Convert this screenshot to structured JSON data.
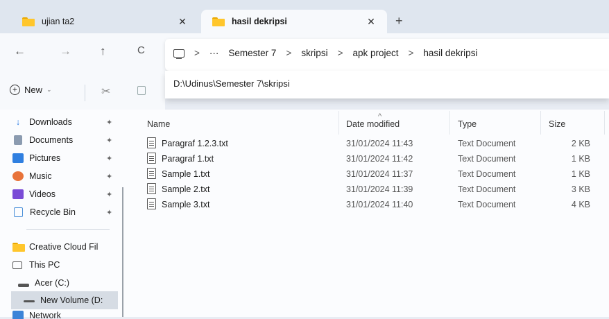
{
  "tabs": [
    {
      "title": "ujian ta2",
      "active": false
    },
    {
      "title": "hasil dekripsi",
      "active": true
    }
  ],
  "tab_close_glyph": "✕",
  "new_tab_glyph": "+",
  "nav": {
    "back": "←",
    "forward": "→",
    "up": "↑",
    "refresh": "C"
  },
  "breadcrumb": {
    "overflow": "···",
    "separator": ">",
    "items": [
      "Semester 7",
      "skripsi",
      "apk project",
      "hasil dekripsi"
    ]
  },
  "address_suggestion": "D:\\Udinus\\Semester 7\\skripsi",
  "toolbar": {
    "new_label": "New",
    "new_chevron": "⌄"
  },
  "sidebar": {
    "quick_access": [
      {
        "label": "Downloads",
        "icon": "download-icon",
        "pinned": true
      },
      {
        "label": "Documents",
        "icon": "documents-icon",
        "pinned": true
      },
      {
        "label": "Pictures",
        "icon": "pictures-icon",
        "pinned": true
      },
      {
        "label": "Music",
        "icon": "music-icon",
        "pinned": true
      },
      {
        "label": "Videos",
        "icon": "videos-icon",
        "pinned": true
      },
      {
        "label": "Recycle Bin",
        "icon": "recycle-bin-icon",
        "pinned": true
      }
    ],
    "locations": [
      {
        "label": "Creative Cloud Fil",
        "icon": "folder-icon"
      },
      {
        "label": "This PC",
        "icon": "this-pc-icon"
      },
      {
        "label": "Acer (C:)",
        "icon": "drive-icon"
      },
      {
        "label": "New Volume (D:",
        "icon": "drive-icon",
        "selected": true
      },
      {
        "label": "Network",
        "icon": "network-icon"
      }
    ]
  },
  "table": {
    "columns": [
      "Name",
      "Date modified",
      "Type",
      "Size"
    ],
    "rows": [
      {
        "name": "Paragraf 1.2.3.txt",
        "date": "31/01/2024 11:43",
        "type": "Text Document",
        "size": "2 KB"
      },
      {
        "name": "Paragraf 1.txt",
        "date": "31/01/2024 11:42",
        "type": "Text Document",
        "size": "1 KB"
      },
      {
        "name": "Sample 1.txt",
        "date": "31/01/2024 11:37",
        "type": "Text Document",
        "size": "1 KB"
      },
      {
        "name": "Sample 2.txt",
        "date": "31/01/2024 11:39",
        "type": "Text Document",
        "size": "3 KB"
      },
      {
        "name": "Sample 3.txt",
        "date": "31/01/2024 11:40",
        "type": "Text Document",
        "size": "4 KB"
      }
    ]
  }
}
